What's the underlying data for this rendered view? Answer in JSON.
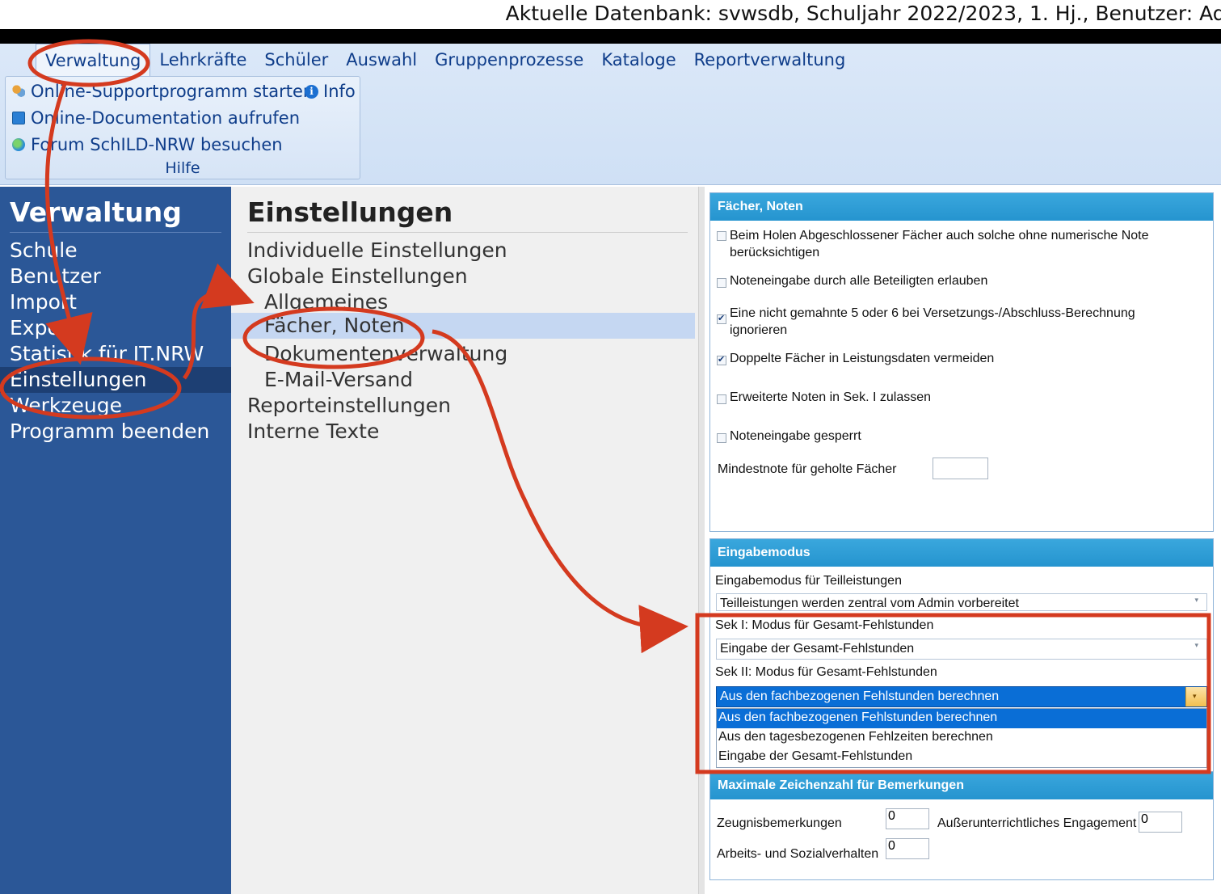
{
  "window": {
    "status_text": "Aktuelle Datenbank: svwsdb, Schuljahr 2022/2023, 1. Hj., Benutzer: Adm"
  },
  "ribbon": {
    "tabs": [
      "Verwaltung",
      "Lehrkräfte",
      "Schüler",
      "Auswahl",
      "Gruppenprozesse",
      "Kataloge",
      "Reportverwaltung"
    ],
    "group": {
      "items": [
        "Online-Supportprogramm starten",
        "Online-Documentation aufrufen",
        "Forum SchILD-NRW besuchen"
      ],
      "info": "Info",
      "label": "Hilfe"
    }
  },
  "left_nav": {
    "title": "Verwaltung",
    "items": [
      "Schule",
      "Benutzer",
      "Import",
      "Export",
      "Statistik für IT.NRW",
      "Einstellungen",
      "Werkzeuge",
      "Programm beenden"
    ],
    "selected": "Einstellungen"
  },
  "mid_nav": {
    "title": "Einstellungen",
    "items": [
      "Individuelle Einstellungen",
      "Globale Einstellungen",
      "Allgemeines",
      "Fächer, Noten",
      "Dokumentenverwaltung",
      "E-Mail-Versand",
      "Reporteinstellungen",
      "Interne Texte"
    ],
    "selected": "Fächer, Noten"
  },
  "panel_faecher": {
    "title": "Fächer, Noten",
    "checkboxes": [
      {
        "label": "Beim Holen Abgeschlossener Fächer auch solche ohne numerische Note berücksichtigen",
        "checked": false
      },
      {
        "label": "Noteneingabe durch alle Beteiligten erlauben",
        "checked": false
      },
      {
        "label": "Eine nicht gemahnte 5 oder 6 bei Versetzungs-/Abschluss-Berechnung ignorieren",
        "checked": true
      },
      {
        "label": "Doppelte Fächer in Leistungsdaten vermeiden",
        "checked": true
      },
      {
        "label": "Erweiterte Noten in Sek. I zulassen",
        "checked": false
      },
      {
        "label": "Noteneingabe gesperrt",
        "checked": false
      }
    ],
    "mindestnote_label": "Mindestnote für geholte Fächer",
    "mindestnote_value": ""
  },
  "panel_eingabe": {
    "title": "Eingabemodus",
    "teilleistungen_label": "Eingabemodus für Teilleistungen",
    "teilleistungen_value": "Teilleistungen werden zentral vom Admin vorbereitet",
    "sek1_label": "Sek I: Modus für Gesamt-Fehlstunden",
    "sek1_value": "Eingabe der Gesamt-Fehlstunden",
    "sek2_label": "Sek II: Modus für Gesamt-Fehlstunden",
    "sek2_value": "Aus den fachbezogenen Fehlstunden berechnen",
    "sek2_options": [
      "Aus den fachbezogenen Fehlstunden berechnen",
      "Aus den tagesbezogenen Fehlzeiten berechnen",
      "Eingabe der Gesamt-Fehlstunden"
    ]
  },
  "panel_zeichen": {
    "title": "Maximale Zeichenzahl für Bemerkungen",
    "zeugnis_label": "Zeugnisbemerkungen",
    "zeugnis_value": "0",
    "ausser_label": "Außerunterrichtliches Engagement",
    "ausser_value": "0",
    "asv_label": "Arbeits- und Sozialverhalten",
    "asv_value": "0"
  },
  "colors": {
    "nav_blue": "#2b5797",
    "header_cyan": "#2594cf",
    "annotation_red": "#d43a1f",
    "selection_blue": "#0a6ed6"
  }
}
